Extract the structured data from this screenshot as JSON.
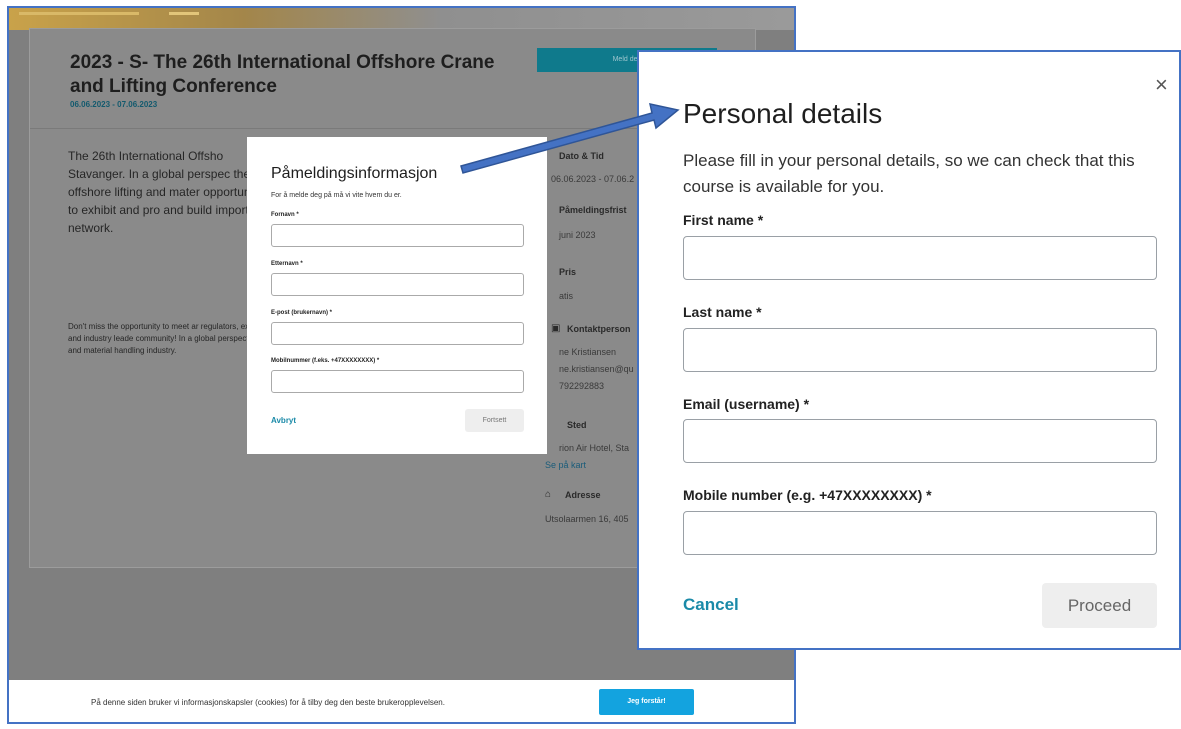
{
  "background_page": {
    "title": "2023 - S- The 26th International Offshore Crane and Lifting Conference",
    "dates": "06.06.2023 - 07.06.2023",
    "register_button": "Meld deg",
    "description_1": "The 26th International Offsho Stavanger. In a global perspec the offshore lifting and mater opportunity to exhibit and pro and build important network.",
    "description_2": "Don't miss the opportunity to meet ar regulators, experts and industry leade community! In a global perspective th and material handling industry.",
    "side_info": {
      "date_time_heading": "Dato & Tid",
      "date_time_value": "06.06.2023 - 07.06.2",
      "deadline_heading": "Påmeldingsfrist",
      "deadline_value": "juni 2023",
      "price_heading": "Pris",
      "price_value": "atis",
      "contact_heading": "Kontaktperson",
      "contact_name": "ne Kristiansen",
      "contact_email": "ne.kristiansen@qu",
      "contact_phone": "792292883",
      "place_heading": "Sted",
      "place_value": "rion Air Hotel, Sta",
      "map_link": "Se på kart",
      "address_heading": "Adresse",
      "address_value": "Utsolaarmen 16, 405"
    }
  },
  "small_dialog": {
    "title": "Påmeldingsinformasjon",
    "subtitle": "For å melde deg på må vi vite hvem du er.",
    "fields": [
      {
        "label": "Fornavn *"
      },
      {
        "label": "Etternavn *"
      },
      {
        "label": "E-post (brukernavn) *"
      },
      {
        "label": "Mobilnummer (f.eks. +47XXXXXXXX) *"
      }
    ],
    "cancel_label": "Avbryt",
    "proceed_label": "Fortsett"
  },
  "cookie_bar": {
    "text": "På denne siden bruker vi informasjonskapsler (cookies) for å tilby deg den beste brukeropplevelsen.",
    "button_label": "Jeg forstår!"
  },
  "zoom_dialog": {
    "close_symbol": "×",
    "title": "Personal details",
    "subtitle": "Please fill in your personal details, so we can check that this course is available for you.",
    "fields": [
      {
        "label": "First name *"
      },
      {
        "label": "Last name *"
      },
      {
        "label": "Email (username) *"
      },
      {
        "label": "Mobile number (e.g. +47XXXXXXXX) *"
      }
    ],
    "cancel_label": "Cancel",
    "proceed_label": "Proceed"
  },
  "colors": {
    "accent": "#1a8aa8",
    "frame_border": "#4472c4",
    "cookie_button": "#13a3df",
    "overlay": "#7f7f7f"
  }
}
